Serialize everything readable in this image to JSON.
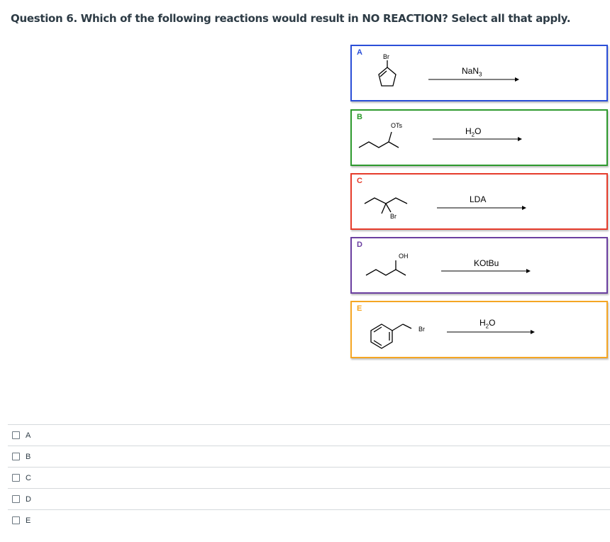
{
  "question": {
    "text": "Question 6. Which of the following reactions would result in NO REACTION? Select all that apply."
  },
  "reactions": [
    {
      "label": "A",
      "color": "#2b4fd8",
      "atom_labels": [
        "Br"
      ],
      "reagent": "NaN",
      "reagent_sub": "3",
      "reagent_tail": ""
    },
    {
      "label": "B",
      "color": "#2e9a2e",
      "atom_labels": [
        "OTs"
      ],
      "reagent": "H",
      "reagent_sub": "2",
      "reagent_tail": "O"
    },
    {
      "label": "C",
      "color": "#e63c2b",
      "atom_labels": [
        "Br"
      ],
      "reagent": "LDA",
      "reagent_sub": "",
      "reagent_tail": ""
    },
    {
      "label": "D",
      "color": "#6b3fa0",
      "atom_labels": [
        "OH"
      ],
      "reagent": "KOtBu",
      "reagent_sub": "",
      "reagent_tail": ""
    },
    {
      "label": "E",
      "color": "#f5a623",
      "atom_labels": [
        "Br"
      ],
      "reagent": "H",
      "reagent_sub": "2",
      "reagent_tail": "O"
    }
  ],
  "options": [
    {
      "label": "A",
      "checked": false
    },
    {
      "label": "B",
      "checked": false
    },
    {
      "label": "C",
      "checked": false
    },
    {
      "label": "D",
      "checked": false
    },
    {
      "label": "E",
      "checked": false
    }
  ]
}
